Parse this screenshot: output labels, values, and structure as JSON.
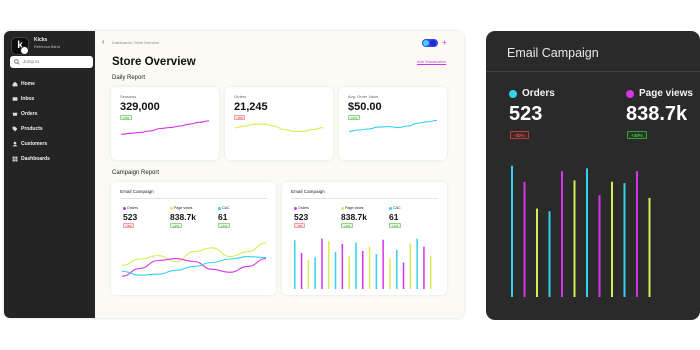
{
  "colors": {
    "pink": "#d635e6",
    "cyan": "#35d2ec",
    "lime": "#d8ed55",
    "sidebar": "#242424",
    "dark_panel": "#2a2a2a"
  },
  "sidebar": {
    "brand_letter": "k",
    "brand_name": "Kicks",
    "user": "Rebecca Blind",
    "search_placeholder": "Jump to",
    "items": [
      {
        "label": "Home",
        "icon": "home-icon"
      },
      {
        "label": "Inbox",
        "icon": "inbox-icon"
      },
      {
        "label": "Orders",
        "icon": "orders-icon"
      },
      {
        "label": "Products",
        "icon": "tag-icon"
      },
      {
        "label": "Customers",
        "icon": "users-icon"
      },
      {
        "label": "Dashboards",
        "icon": "dashboard-icon"
      }
    ]
  },
  "header": {
    "breadcrumb": "Dashboards / Store Overview",
    "title": "Store Overview",
    "add_link": "Add Visualization",
    "plus": "+"
  },
  "daily": {
    "title": "Daily Report",
    "kpis": [
      {
        "label": "Sessions",
        "value": "329,000",
        "badge": "+3%",
        "dir": "up",
        "color": "#d635e6",
        "trend": [
          0.28,
          0.32,
          0.36,
          0.42,
          0.52,
          0.56,
          0.62,
          0.7,
          0.78,
          0.84
        ]
      },
      {
        "label": "Orders",
        "value": "21,245",
        "badge": "-2%",
        "dir": "down",
        "color": "#d8ed55",
        "trend": [
          0.55,
          0.62,
          0.7,
          0.7,
          0.62,
          0.48,
          0.4,
          0.4,
          0.48,
          0.56
        ]
      },
      {
        "label": "Avg. Order Value",
        "value": "$50.00",
        "badge": "+1%",
        "dir": "up",
        "color": "#35d2ec",
        "trend": [
          0.4,
          0.46,
          0.5,
          0.58,
          0.6,
          0.56,
          0.62,
          0.74,
          0.8,
          0.86
        ]
      }
    ]
  },
  "campaign": {
    "title": "Campaign Report",
    "cards": [
      {
        "title": "Email Campaign",
        "metrics": [
          {
            "label": "Orders",
            "value": "523",
            "badge": "-3%",
            "dir": "down",
            "color": "#d635e6"
          },
          {
            "label": "Page views",
            "value": "838.7k",
            "badge": "+2%",
            "dir": "up",
            "color": "#d8ed55"
          },
          {
            "label": "CAC",
            "value": "61",
            "badge": "+1%",
            "dir": "up",
            "color": "#35d2ec"
          }
        ],
        "lines": [
          {
            "color": "#d8ed55",
            "values": [
              0.42,
              0.55,
              0.62,
              0.5,
              0.7,
              0.78,
              0.6,
              0.7,
              0.88
            ]
          },
          {
            "color": "#d635e6",
            "values": [
              0.2,
              0.36,
              0.52,
              0.56,
              0.5,
              0.34,
              0.28,
              0.4,
              0.56
            ]
          },
          {
            "color": "#35d2ec",
            "values": [
              0.3,
              0.22,
              0.24,
              0.32,
              0.4,
              0.48,
              0.55,
              0.6,
              0.58
            ]
          }
        ]
      },
      {
        "title": "Email Campaign",
        "metrics": [
          {
            "label": "Orders",
            "value": "523",
            "badge": "-3%",
            "dir": "down",
            "color": "#d635e6"
          },
          {
            "label": "Page views",
            "value": "838.7k",
            "badge": "+2%",
            "dir": "up",
            "color": "#d8ed55"
          },
          {
            "label": "CAC",
            "value": "61",
            "badge": "+1%",
            "dir": "up",
            "color": "#35d2ec"
          }
        ],
        "bars": [
          {
            "color": "#35d2ec",
            "value": 0.92
          },
          {
            "color": "#d635e6",
            "value": 0.68
          },
          {
            "color": "#d8ed55",
            "value": 0.55
          },
          {
            "color": "#35d2ec",
            "value": 0.6
          },
          {
            "color": "#d635e6",
            "value": 0.95
          },
          {
            "color": "#d8ed55",
            "value": 0.9
          },
          {
            "color": "#35d2ec",
            "value": 0.7
          },
          {
            "color": "#d635e6",
            "value": 0.85
          },
          {
            "color": "#d8ed55",
            "value": 0.62
          },
          {
            "color": "#35d2ec",
            "value": 0.88
          },
          {
            "color": "#d635e6",
            "value": 0.72
          },
          {
            "color": "#d8ed55",
            "value": 0.8
          },
          {
            "color": "#35d2ec",
            "value": 0.66
          },
          {
            "color": "#d635e6",
            "value": 0.93
          },
          {
            "color": "#d8ed55",
            "value": 0.58
          },
          {
            "color": "#35d2ec",
            "value": 0.74
          },
          {
            "color": "#d635e6",
            "value": 0.5
          },
          {
            "color": "#d8ed55",
            "value": 0.86
          },
          {
            "color": "#35d2ec",
            "value": 0.95
          },
          {
            "color": "#d635e6",
            "value": 0.8
          },
          {
            "color": "#d8ed55",
            "value": 0.62
          }
        ]
      }
    ]
  },
  "panel": {
    "title": "Email Campaign",
    "metrics": [
      {
        "label": "Orders",
        "value": "523",
        "badge": "-30%",
        "dir": "down",
        "color": "#35d2ec"
      },
      {
        "label": "Page views",
        "value": "838.7k",
        "badge": "+30%",
        "dir": "up",
        "color": "#d635e6"
      }
    ],
    "bars": [
      {
        "color": "#35d2ec",
        "value": 0.98
      },
      {
        "color": "#d635e6",
        "value": 0.86
      },
      {
        "color": "#d8ed55",
        "value": 0.66
      },
      {
        "color": "#35d2ec",
        "value": 0.64
      },
      {
        "color": "#d635e6",
        "value": 0.94
      },
      {
        "color": "#d8ed55",
        "value": 0.87
      },
      {
        "color": "#35d2ec",
        "value": 0.96
      },
      {
        "color": "#d635e6",
        "value": 0.76
      },
      {
        "color": "#d8ed55",
        "value": 0.86
      },
      {
        "color": "#35d2ec",
        "value": 0.85
      },
      {
        "color": "#d635e6",
        "value": 0.94
      },
      {
        "color": "#d8ed55",
        "value": 0.74
      }
    ]
  }
}
